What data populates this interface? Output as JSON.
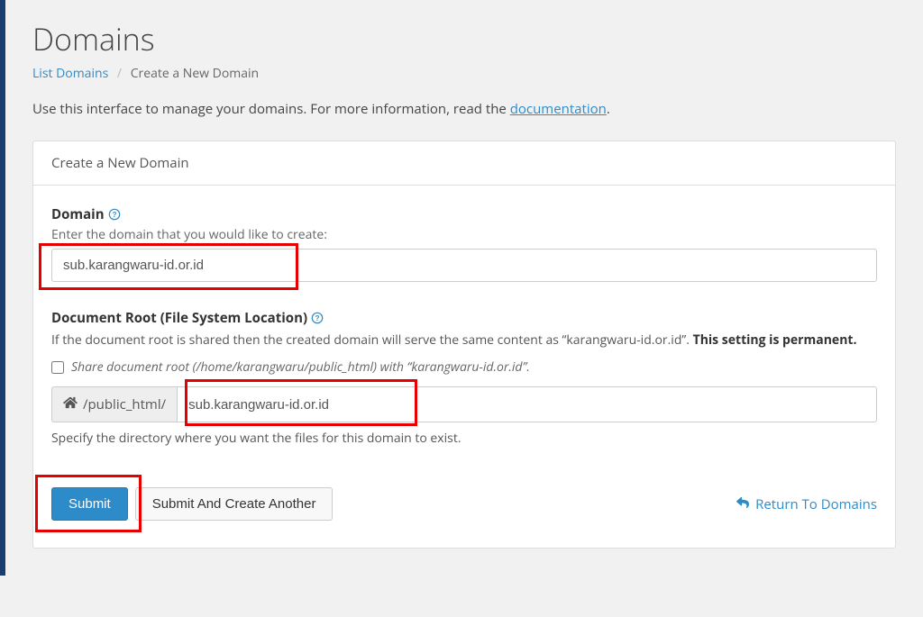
{
  "page": {
    "title": "Domains",
    "intro_prefix": "Use this interface to manage your domains. For more information, read the ",
    "intro_link": "documentation",
    "intro_suffix": "."
  },
  "breadcrumb": {
    "list_link": "List Domains",
    "current": "Create a New Domain"
  },
  "panel": {
    "heading": "Create a New Domain"
  },
  "domain_field": {
    "label": "Domain",
    "desc": "Enter the domain that you would like to create:",
    "value": "sub.karangwaru-id.or.id"
  },
  "docroot": {
    "label": "Document Root (File System Location)",
    "note_prefix": "If the document root is shared then the created domain will serve the same content as “",
    "note_domain": "karangwaru-id.or.id",
    "note_suffix": "”. ",
    "note_bold": "This setting is permanent.",
    "share_checkbox_label": "Share document root (/home/karangwaru/public_html) with “karangwaru-id.or.id”.",
    "addon_text": "/public_html/",
    "value": "sub.karangwaru-id.or.id",
    "dir_note": "Specify the directory where you want the files for this domain to exist."
  },
  "actions": {
    "submit": "Submit",
    "submit_another": "Submit And Create Another",
    "return": "Return To Domains"
  }
}
